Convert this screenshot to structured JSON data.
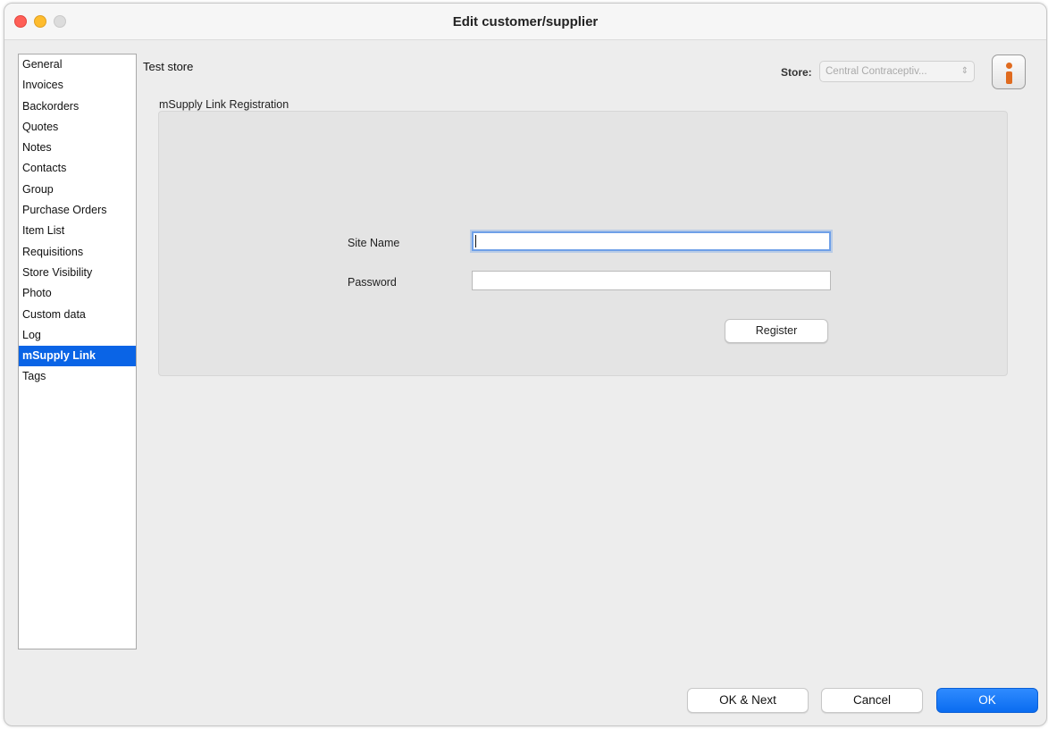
{
  "window": {
    "title": "Edit customer/supplier"
  },
  "sidebar": {
    "items": [
      {
        "label": "General"
      },
      {
        "label": "Invoices"
      },
      {
        "label": "Backorders"
      },
      {
        "label": "Quotes"
      },
      {
        "label": "Notes"
      },
      {
        "label": "Contacts"
      },
      {
        "label": "Group"
      },
      {
        "label": "Purchase Orders"
      },
      {
        "label": "Item List"
      },
      {
        "label": "Requisitions"
      },
      {
        "label": "Store Visibility"
      },
      {
        "label": "Photo"
      },
      {
        "label": "Custom data"
      },
      {
        "label": "Log"
      },
      {
        "label": "mSupply Link",
        "selected": true
      },
      {
        "label": "Tags"
      }
    ]
  },
  "header": {
    "store_name": "Test store",
    "store_label": "Store:",
    "store_value": "Central Contraceptiv...",
    "info_icon": "info-icon"
  },
  "registration": {
    "group_label": "mSupply Link Registration",
    "site_name_label": "Site Name",
    "site_name_value": "",
    "password_label": "Password",
    "password_value": "",
    "register_label": "Register"
  },
  "footer": {
    "ok_next_label": "OK & Next",
    "cancel_label": "Cancel",
    "ok_label": "OK"
  },
  "colors": {
    "selection": "#0a64e6",
    "primary_button": "#0a6cf0",
    "info_accent": "#e06b1f"
  }
}
